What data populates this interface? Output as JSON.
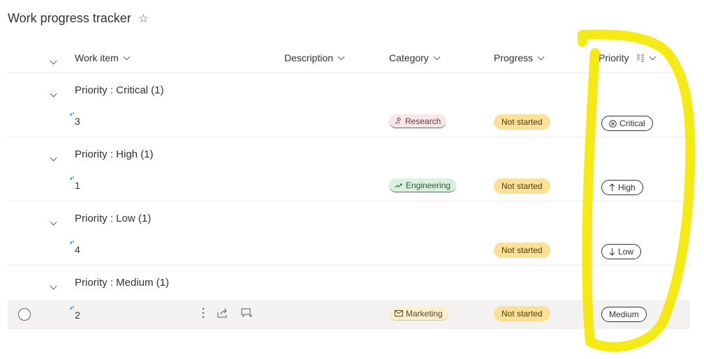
{
  "page": {
    "title": "Work progress tracker"
  },
  "columns": {
    "work_item": "Work item",
    "description": "Description",
    "category": "Category",
    "progress": "Progress",
    "priority": "Priority"
  },
  "groups": [
    {
      "title": "Priority : Critical (1)",
      "item": {
        "id": "3",
        "category": "Research",
        "progress": "Not started",
        "priority": "Critical"
      }
    },
    {
      "title": "Priority : High (1)",
      "item": {
        "id": "1",
        "category": "Engineering",
        "progress": "Not started",
        "priority": "High"
      }
    },
    {
      "title": "Priority : Low (1)",
      "item": {
        "id": "4",
        "category": "",
        "progress": "Not started",
        "priority": "Low"
      }
    },
    {
      "title": "Priority : Medium (1)",
      "item": {
        "id": "2",
        "category": "Marketing",
        "progress": "Not started",
        "priority": "Medium"
      }
    }
  ],
  "colors": {
    "highlight": "#f5e800",
    "progress_bg": "#fbe197",
    "research_bg": "#f9e6e8",
    "engineering_bg": "#d9f1de",
    "marketing_bg": "#fbefd0"
  }
}
